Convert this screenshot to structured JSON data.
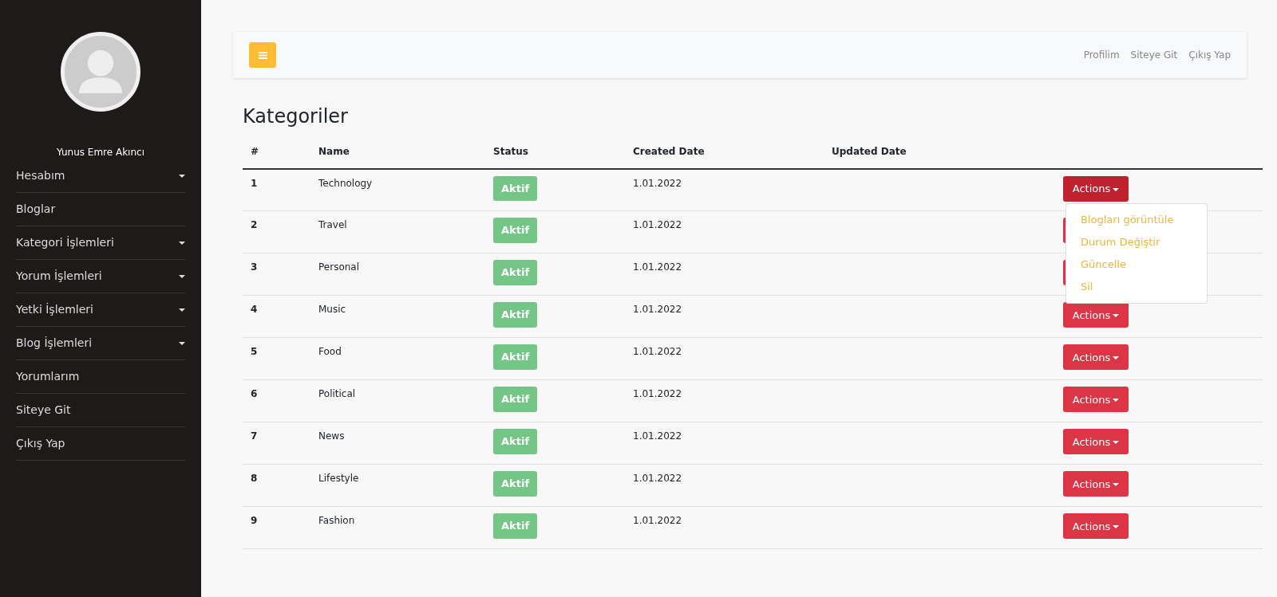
{
  "sidebar": {
    "user_name": "Yunus Emre Akıncı",
    "items": [
      {
        "label": "Hesabım",
        "has_submenu": true
      },
      {
        "label": "Bloglar",
        "has_submenu": false
      },
      {
        "label": "Kategori İşlemleri",
        "has_submenu": true
      },
      {
        "label": "Yorum İşlemleri",
        "has_submenu": true
      },
      {
        "label": "Yetki İşlemleri",
        "has_submenu": true
      },
      {
        "label": "Blog İşlemleri",
        "has_submenu": true
      },
      {
        "label": "Yorumlarım",
        "has_submenu": false
      },
      {
        "label": "Siteye Git",
        "has_submenu": false
      },
      {
        "label": "Çıkış Yap",
        "has_submenu": false
      }
    ]
  },
  "topbar": {
    "links": [
      "Profilim",
      "Siteye Git",
      "Çıkış Yap"
    ]
  },
  "page_title": "Kategoriler",
  "table": {
    "columns": [
      "#",
      "Name",
      "Status",
      "Created Date",
      "Updated Date"
    ],
    "rows": [
      {
        "id": "1",
        "name": "Technology",
        "status": "Aktif",
        "created": "1.01.2022",
        "actions": "Actions",
        "expanded": true
      },
      {
        "id": "2",
        "name": "Travel",
        "status": "Aktif",
        "created": "1.01.2022",
        "expanded": false
      },
      {
        "id": "3",
        "name": "Personal",
        "status": "Aktif",
        "created": "1.01.2022",
        "expanded": false
      },
      {
        "id": "4",
        "name": "Music",
        "status": "Aktif",
        "created": "1.01.2022",
        "actions": "Actions",
        "expanded": false
      },
      {
        "id": "5",
        "name": "Food",
        "status": "Aktif",
        "created": "1.01.2022",
        "actions": "Actions",
        "expanded": false
      },
      {
        "id": "6",
        "name": "Political",
        "status": "Aktif",
        "created": "1.01.2022",
        "actions": "Actions",
        "expanded": false
      },
      {
        "id": "7",
        "name": "News",
        "status": "Aktif",
        "created": "1.01.2022",
        "actions": "Actions",
        "expanded": false
      },
      {
        "id": "8",
        "name": "Lifestyle",
        "status": "Aktif",
        "created": "1.01.2022",
        "actions": "Actions",
        "expanded": false
      },
      {
        "id": "9",
        "name": "Fashion",
        "status": "Aktif",
        "created": "1.01.2022",
        "actions": "Actions",
        "expanded": false
      }
    ]
  },
  "actions_menu": [
    "Blogları görüntüle",
    "Durum Değiştir",
    "Güncelle",
    "Sil"
  ]
}
